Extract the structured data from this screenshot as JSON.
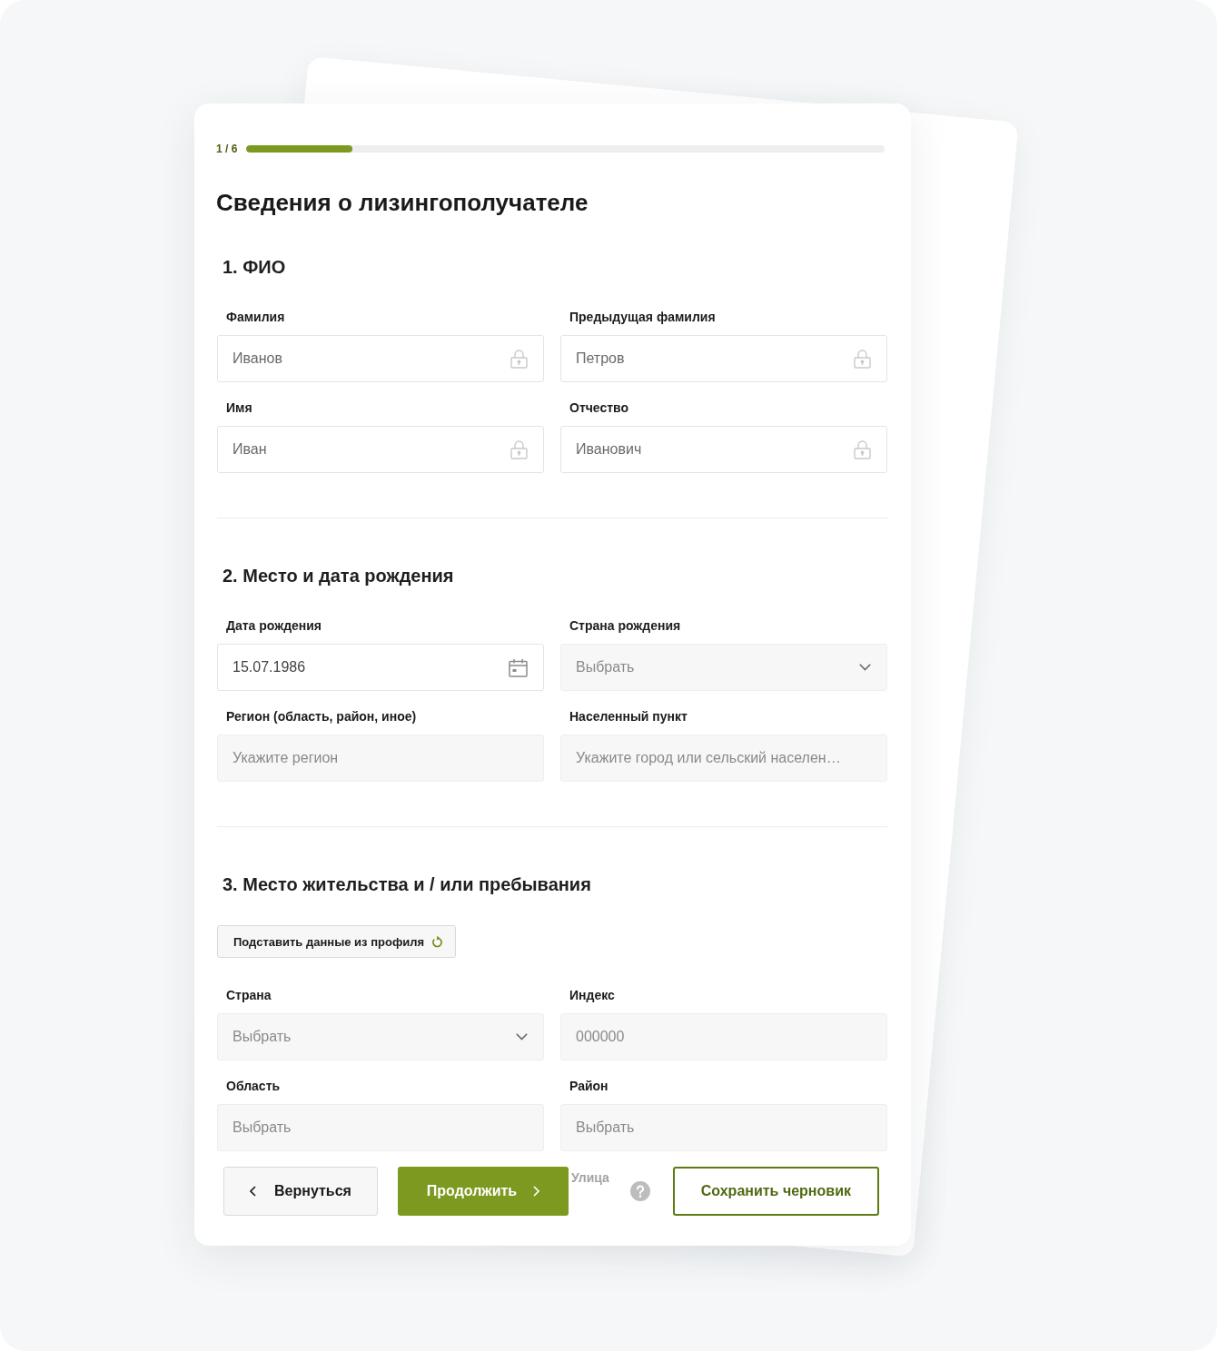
{
  "progress": {
    "step": "1 / 6",
    "level": 0.1667
  },
  "title": "Сведения о лизингополучателе",
  "sections": [
    {
      "heading": "1. ФИО",
      "fields": [
        {
          "label": "Фамилия",
          "kind": "locked",
          "value": "Иванов"
        },
        {
          "label": "Предыдущая фамилия",
          "kind": "locked",
          "value": "Петров"
        },
        {
          "label": "Имя",
          "kind": "locked",
          "value": "Иван"
        },
        {
          "label": "Отчество",
          "kind": "locked",
          "value": "Иванович"
        }
      ]
    },
    {
      "heading": "2. Место и дата рождения",
      "fields": [
        {
          "label": "Дата рождения",
          "kind": "date",
          "value": "15.07.1986"
        },
        {
          "label": "Страна рождения",
          "kind": "select",
          "placeholder": "Выбрать"
        },
        {
          "label": "Регион (область, район, иное)",
          "kind": "text",
          "placeholder": "Укажите регион"
        },
        {
          "label": "Населенный пункт",
          "kind": "text",
          "placeholder": "Укажите город или сельский населен…"
        }
      ]
    },
    {
      "heading": "3. Место жительства и / или пребывания",
      "fill_button": "Подставить данные из профиля",
      "fields": [
        {
          "label": "Страна",
          "kind": "select",
          "placeholder": "Выбрать"
        },
        {
          "label": "Индекс",
          "kind": "text",
          "placeholder": "000000"
        },
        {
          "label": "Область",
          "kind": "text",
          "placeholder": "Выбрать"
        },
        {
          "label": "Район",
          "kind": "text",
          "placeholder": "Выбрать"
        }
      ]
    }
  ],
  "footer": {
    "back_button": "Вернуться",
    "continue_button": "Продолжить",
    "faded_label": "Улица",
    "save_draft_button": "Сохранить черновик"
  }
}
